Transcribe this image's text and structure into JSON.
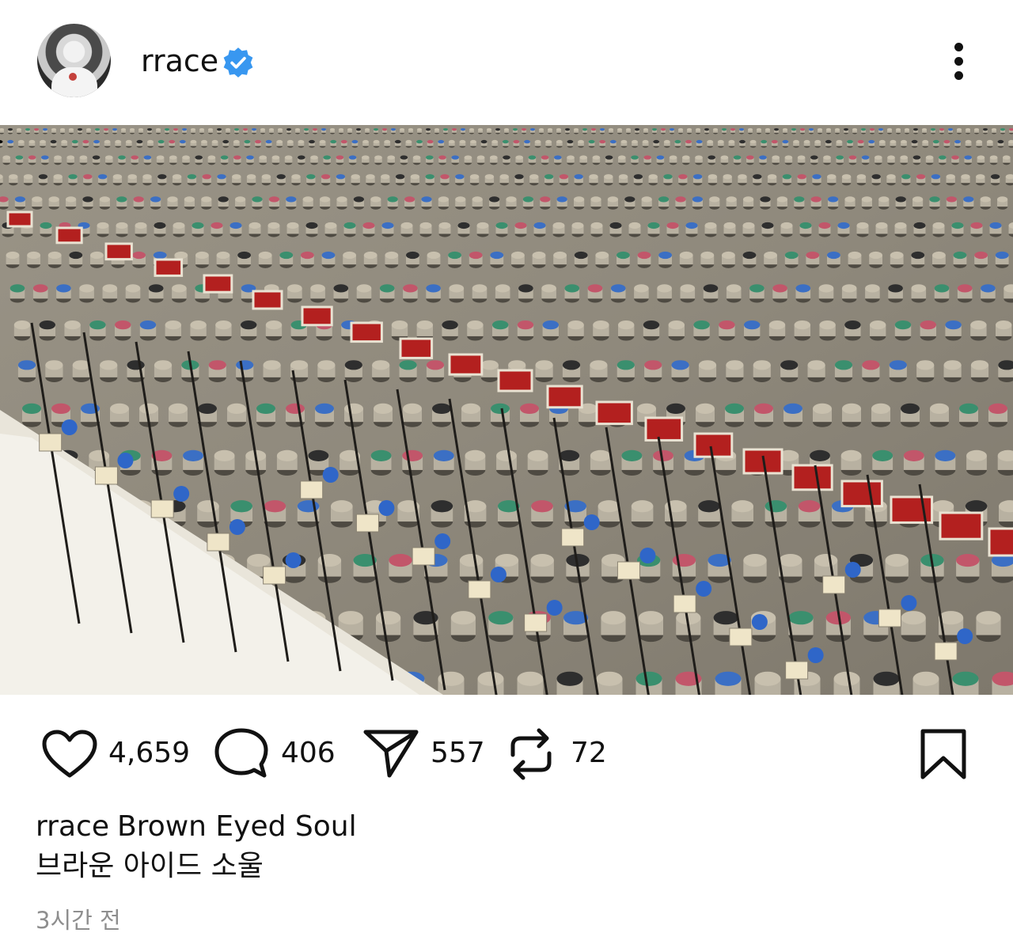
{
  "post": {
    "username": "rrace",
    "verified": true,
    "image_description_icon": "mixing-console-photo",
    "likes": "4,659",
    "comments": "406",
    "shares": "557",
    "reposts": "72",
    "caption_user": "rrace",
    "caption_line1": "Brown Eyed Soul",
    "caption_line2": "브라운 아이드 소울",
    "time_ago": "3시간 전"
  },
  "colors": {
    "verified_blue": "#3897f0",
    "muted_text": "#8e8e8e"
  }
}
